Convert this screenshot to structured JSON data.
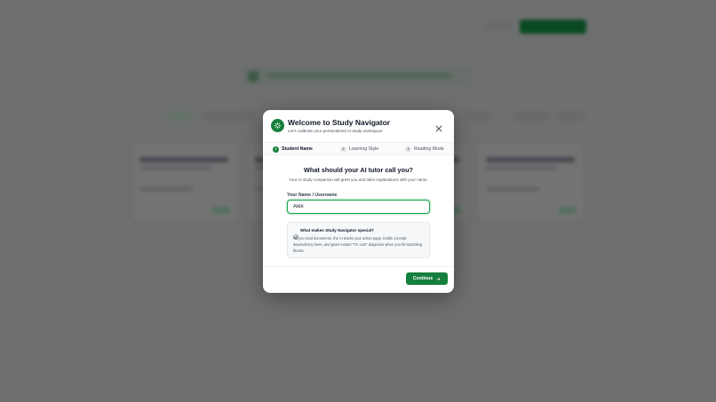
{
  "modal": {
    "title": "Welcome to Study Navigator",
    "subtitle": "Let's calibrate your personalized AI study workspace",
    "close_icon": "close-icon",
    "logo_icon": "sparkle-icon"
  },
  "steps": [
    {
      "number": "1",
      "label": "Student Name",
      "active": true
    },
    {
      "number": "2",
      "label": "Learning Style",
      "active": false
    },
    {
      "number": "3",
      "label": "Reading Mode",
      "active": false
    }
  ],
  "question": {
    "title": "What should your AI tutor call you?",
    "subtitle": "Your AI study companion will greet you and tailor explanations with your name."
  },
  "field": {
    "label": "Your Name / Username",
    "value": "Alex"
  },
  "info": {
    "icon": "badge-check-icon",
    "title": "What makes Study Navigator special?",
    "body": "As you read documents, the AI tracks your active page, builds concept dependency trees, and gives instant \"I'm Lost\" diagnosis when you hit stumbling blocks."
  },
  "footer": {
    "continue_label": "Continue",
    "continue_icon": "arrow-right-icon"
  },
  "colors": {
    "accent": "#15803d",
    "overlay": "rgba(0,0,0,0.55)"
  }
}
